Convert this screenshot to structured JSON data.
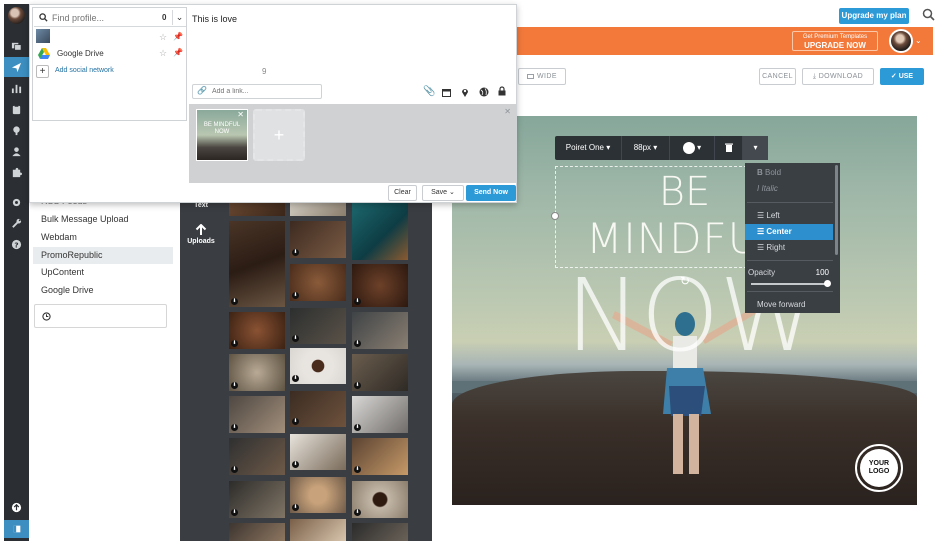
{
  "composer": {
    "find_profile_placeholder": "Find profile...",
    "profile_count": "0",
    "profiles": [
      {
        "name": ""
      },
      {
        "name": "Google Drive"
      }
    ],
    "add_social_network": "Add social network",
    "message_text": "This is love",
    "char_counter": "9",
    "add_link_placeholder": "Add a link...",
    "media_thumb_text": "BE MINDFUL NOW",
    "buttons": {
      "clear": "Clear",
      "save": "Save",
      "send_now": "Send Now"
    }
  },
  "sources": {
    "items": [
      {
        "label": "RSS Feeds"
      },
      {
        "label": "Bulk Message Upload"
      },
      {
        "label": "Webdam"
      },
      {
        "label": "PromoRepublic"
      },
      {
        "label": "UpContent"
      },
      {
        "label": "Google Drive"
      }
    ],
    "selected_index": 3
  },
  "editor_tools": {
    "text_label": "Text",
    "uploads_label": "Uploads"
  },
  "header": {
    "upgrade_plan": "Upgrade my plan",
    "premium_line1": "Get Premium Templates",
    "premium_line2": "UPGRADE NOW"
  },
  "toolbar": {
    "wide": "WIDE",
    "cancel": "CANCEL",
    "download": "DOWNLOAD",
    "use": "USE"
  },
  "text_toolbar": {
    "font": "Poiret One",
    "size": "88px"
  },
  "format_menu": {
    "bold": "Bold",
    "italic": "Italic",
    "left": "Left",
    "center": "Center",
    "right": "Right",
    "opacity_label": "Opacity",
    "opacity_value": "100",
    "move_forward": "Move forward"
  },
  "canvas": {
    "line1": "BE",
    "line2": "MINDFUL",
    "line3": "NOW",
    "logo_line1": "YOUR",
    "logo_line2": "LOGO"
  },
  "colors": {
    "accent_blue": "#2d9ad8",
    "orange_bar": "#f3793b",
    "rail": "#2b2f33"
  }
}
